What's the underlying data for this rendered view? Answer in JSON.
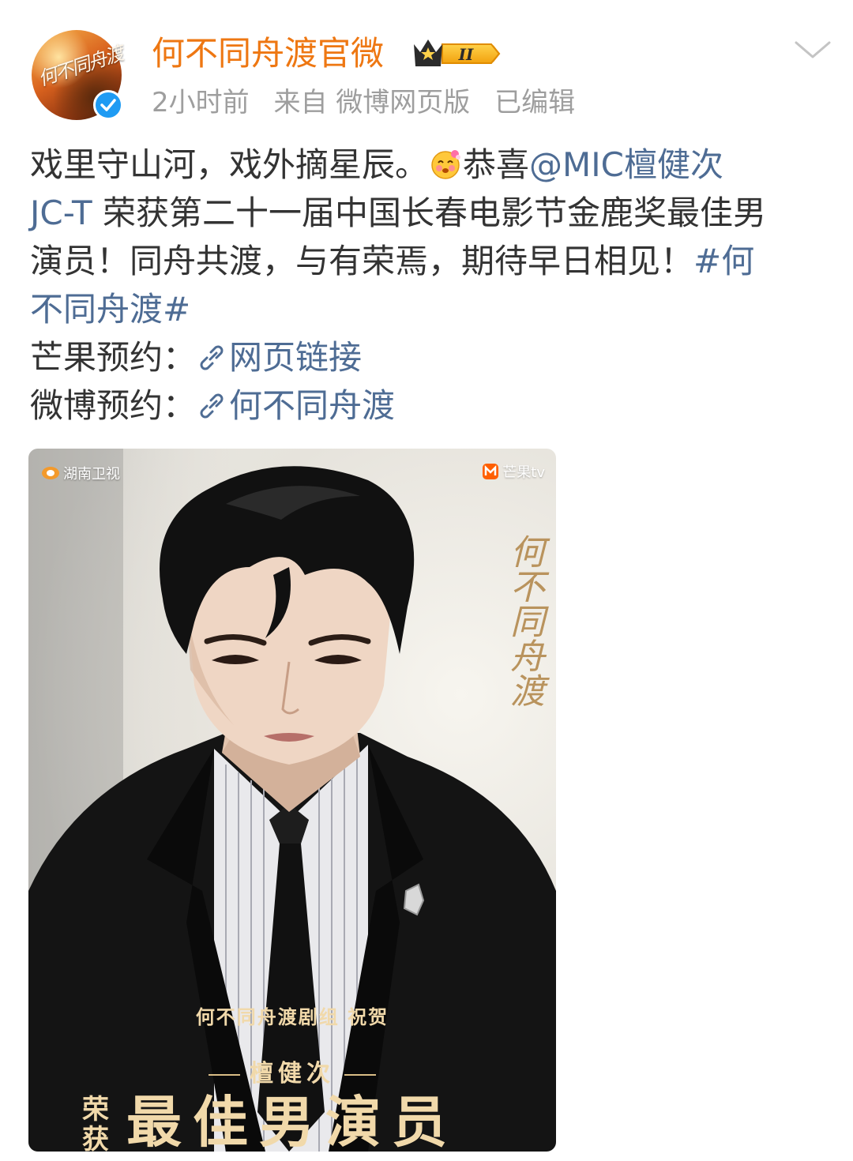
{
  "header": {
    "username": "何不同舟渡官微",
    "badge_level": "II",
    "meta": {
      "time": "2小时前",
      "source": "来自 微博网页版",
      "edited": "已编辑"
    },
    "avatar_text": "何不同舟渡"
  },
  "post": {
    "line1_text": "戏里守山河，戏外摘星辰。",
    "line1_after_emoji": "恭喜",
    "mention": "@MIC檀健次",
    "mention_line2": "JC-T",
    "line2_text": " 荣获第二十一届中国长春电影节金鹿奖最佳男",
    "line3_text": "演员！同舟共渡，与有荣焉，期待早日相见！",
    "hashtag_part1": "#何",
    "hashtag_part2": "不同舟渡#",
    "mango_label": "芒果预约：",
    "mango_link": "网页链接",
    "weibo_label": "微博预约：",
    "weibo_link": "何不同舟渡"
  },
  "poster": {
    "logo_left": "湖南卫视",
    "logo_right": "芒果tv",
    "title_art": "何不同舟渡",
    "caption1": "何不同舟渡剧组 祝贺",
    "caption2": "檀健次",
    "caption3": "最佳男演员",
    "caption_side": "荣获"
  },
  "colors": {
    "username": "#ee7712",
    "link": "#4e6c94",
    "meta": "#9e9e9e",
    "verified": "#1f9bf3"
  }
}
